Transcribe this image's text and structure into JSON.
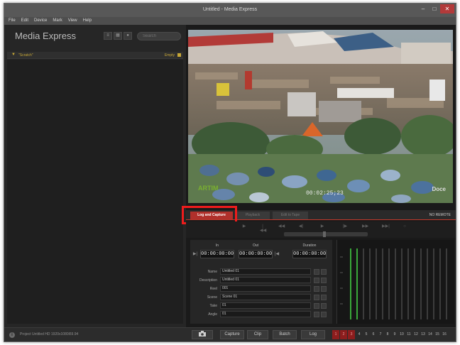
{
  "window": {
    "title": "Untitled - Media Express",
    "controls": [
      "–",
      "□",
      "✕"
    ]
  },
  "menu": [
    "File",
    "Edit",
    "Device",
    "Mark",
    "View",
    "Help"
  ],
  "sidebar": {
    "brand": "Media Express",
    "view_icons": [
      "list-view-icon",
      "thumbnail-view-icon",
      "info-view-icon"
    ],
    "search": {
      "placeholder": "Search",
      "value": ""
    },
    "bin": {
      "name": "\"Scratch\"",
      "status": "Empty"
    }
  },
  "viewer": {
    "timecode": "00:02:25;23",
    "logo_left": "ARTIM",
    "logo_right": "Doce"
  },
  "tabs": [
    {
      "label": "Log and Capture",
      "active": true
    },
    {
      "label": "Playback",
      "active": false
    },
    {
      "label": "Edit to Tape",
      "active": false
    }
  ],
  "remote_status": "NO REMOTE",
  "transport_icons": [
    "▶",
    "|◀◀",
    "◀◀",
    "◀|",
    "▶",
    "|▶",
    "▶▶",
    "▶▶|",
    "○"
  ],
  "clip_panel": {
    "in_label": "In",
    "out_label": "Out",
    "duration_label": "Duration",
    "in_value": "00:00:00:00",
    "out_value": "00:00:00:00",
    "duration_value": "00:00:00:00",
    "fields": [
      {
        "label": "Name",
        "value": "Untitled 01"
      },
      {
        "label": "Description",
        "value": "Untitled 01"
      },
      {
        "label": "Reel",
        "value": "001"
      },
      {
        "label": "Scene",
        "value": "Scene 01"
      },
      {
        "label": "Take",
        "value": "01"
      },
      {
        "label": "Angle",
        "value": "01"
      }
    ]
  },
  "meters": {
    "channel_count": 16,
    "active_channels": [
      1,
      2
    ]
  },
  "bottom": {
    "project_info": "Project Untitled HD 1920x1080i59.94",
    "buttons": [
      "Capture",
      "Clip",
      "Batch",
      "Log"
    ],
    "channels": [
      "1",
      "2",
      "3",
      "4",
      "5",
      "6",
      "7",
      "8",
      "9",
      "10",
      "11",
      "12",
      "13",
      "14",
      "15",
      "16"
    ],
    "armed_channels": [
      1,
      2,
      3
    ]
  },
  "colors": {
    "accent": "#b0302b",
    "highlight": "#ee1c1c",
    "meter_green": "#3aa83a",
    "bin_text": "#c8a837"
  }
}
